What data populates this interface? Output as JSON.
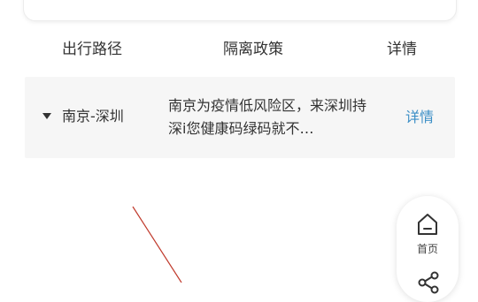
{
  "table": {
    "headers": {
      "route": "出行路径",
      "policy": "隔离政策",
      "detail": "详情"
    },
    "rows": [
      {
        "route": "南京-深圳",
        "policy": "南京为疫情低风险区，来深圳持深i您健康码绿码就不…",
        "detail_link": "详情"
      }
    ]
  },
  "float_nav": {
    "home_label": "首页",
    "home_icon": "home-icon",
    "share_icon": "share-icon"
  },
  "colors": {
    "link": "#3c8fc6",
    "row_background": "#f6f6f6",
    "annotation_line": "#c0392b"
  }
}
